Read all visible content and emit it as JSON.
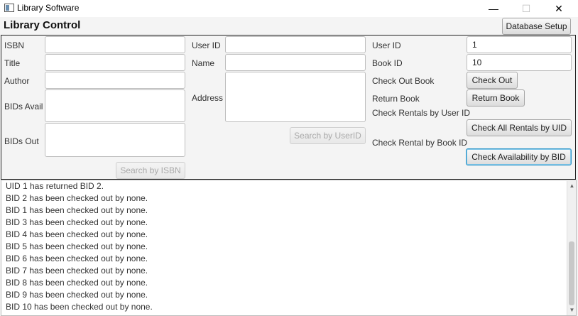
{
  "window": {
    "title": "Library Software",
    "minimize": "—",
    "maximize": "☐",
    "close": "✕"
  },
  "header": {
    "title": "Library Control",
    "db_button": "Database Setup"
  },
  "book_panel": {
    "isbn_label": "ISBN",
    "title_label": "Title",
    "author_label": "Author",
    "bids_avail_label": "BIDs Avail",
    "bids_out_label": "BIDs Out",
    "isbn_value": "",
    "title_value": "",
    "author_value": "",
    "bids_avail_value": "",
    "bids_out_value": "",
    "search_button": "Search by ISBN"
  },
  "user_panel": {
    "user_id_label": "User ID",
    "name_label": "Name",
    "address_label": "Address",
    "user_id_value": "",
    "name_value": "",
    "address_value": "",
    "search_button": "Search by UserID"
  },
  "rental_panel": {
    "user_id_label": "User ID",
    "user_id_value": "1",
    "book_id_label": "Book ID",
    "book_id_value": "10",
    "check_out_label": "Check Out Book",
    "check_out_button": "Check Out",
    "return_label": "Return Book",
    "return_button": "Return Book",
    "rentals_by_user_label": "Check Rentals by User ID",
    "rentals_by_user_button": "Check All Rentals by UID",
    "rental_by_book_label": "Check Rental by Book ID",
    "rental_by_book_button": "Check Availability by BID"
  },
  "output": {
    "lines": [
      "UID 1 has returned BID 2.",
      "BID 2 has been checked out by none.",
      "BID 1 has been checked out by none.",
      "BID 3 has been checked out by none.",
      "BID 4 has been checked out by none.",
      "BID 5 has been checked out by none.",
      "BID 6 has been checked out by none.",
      "BID 7 has been checked out by none.",
      "BID 8 has been checked out by none.",
      "BID 9 has been checked out by none.",
      "BID 10 has been checked out by none."
    ]
  }
}
